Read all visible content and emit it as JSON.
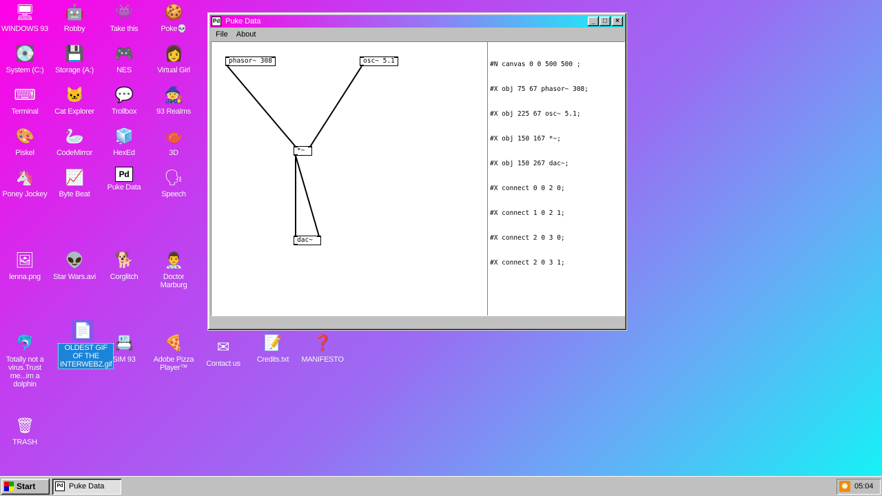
{
  "desktop": {
    "icons": [
      {
        "label": "WINDOWS 93",
        "glyph": "🖥"
      },
      {
        "label": "Robby",
        "glyph": "🤖"
      },
      {
        "label": "Take this",
        "glyph": "👾"
      },
      {
        "label": "Poke💀",
        "glyph": "🍪"
      },
      {
        "label": "System (C:)",
        "glyph": "💽"
      },
      {
        "label": "Storage (A:)",
        "glyph": "💾"
      },
      {
        "label": "NES",
        "glyph": "🎮"
      },
      {
        "label": "Virtual Girl",
        "glyph": "👩"
      },
      {
        "label": "Terminal",
        "glyph": "⌨"
      },
      {
        "label": "Cat Explorer",
        "glyph": "🐱"
      },
      {
        "label": "Trollbox",
        "glyph": "💬"
      },
      {
        "label": "93 Realms",
        "glyph": "🧙"
      },
      {
        "label": "Piskel",
        "glyph": "🎨"
      },
      {
        "label": "CodeMirror",
        "glyph": "🦢"
      },
      {
        "label": "HexEd",
        "glyph": "🧊"
      },
      {
        "label": "3D",
        "glyph": "🫖"
      },
      {
        "label": "Poney Jockey",
        "glyph": "🦄"
      },
      {
        "label": "Byte Beat",
        "glyph": "📈"
      },
      {
        "label": "Puke Data",
        "glyph": "Pd"
      },
      {
        "label": "Speech",
        "glyph": "🗣"
      },
      {
        "label": "lenna.png",
        "glyph": "🖼"
      },
      {
        "label": "Star Wars.avi",
        "glyph": "👽"
      },
      {
        "label": "Corglitch",
        "glyph": "🐕"
      },
      {
        "label": "Doctor Marburg",
        "glyph": "👨‍⚕"
      },
      {
        "label": "Totally not a virus.Trust me...im a dolphin",
        "glyph": "🐬"
      },
      {
        "label": "OLDEST GIF OF THE INTERWEBZ.gif",
        "glyph": "📄"
      },
      {
        "label": "SIM 93",
        "glyph": "📇"
      },
      {
        "label": "Adobe Pizza Player™",
        "glyph": "🍕"
      },
      {
        "label": "Contact us",
        "glyph": "✉"
      },
      {
        "label": "Credits.txt",
        "glyph": "📝"
      },
      {
        "label": "MANIFESTO",
        "glyph": "❓"
      },
      {
        "label": "TRASH",
        "glyph": "🗑"
      }
    ]
  },
  "window": {
    "title": "Puke Data",
    "title_icon": "Pd",
    "controls": {
      "minimize": "_",
      "maximize": "□",
      "close": "×"
    },
    "menu": [
      "File",
      "About"
    ],
    "patch": {
      "objects": [
        {
          "text": "phasor~ 308"
        },
        {
          "text": "osc~ 5.1"
        },
        {
          "text": "*~"
        },
        {
          "text": "dac~"
        }
      ],
      "connections": [
        {
          "from": 0,
          "outlet": 0,
          "to": 2,
          "inlet": 0
        },
        {
          "from": 1,
          "outlet": 0,
          "to": 2,
          "inlet": 1
        },
        {
          "from": 2,
          "outlet": 0,
          "to": 3,
          "inlet": 0
        },
        {
          "from": 2,
          "outlet": 0,
          "to": 3,
          "inlet": 1
        }
      ]
    },
    "source_lines": [
      "#N canvas 0 0 500 500 ;",
      "#X obj 75 67 phasor~ 308;",
      "#X obj 225 67 osc~ 5.1;",
      "#X obj 150 167 *~;",
      "#X obj 150 267 dac~;",
      "#X connect 0 0 2 0;",
      "#X connect 1 0 2 1;",
      "#X connect 2 0 3 0;",
      "#X connect 2 0 3 1;"
    ]
  },
  "taskbar": {
    "start_label": "Start",
    "task_label": "Puke Data",
    "task_icon": "Pd",
    "tray_icon": "rss-icon",
    "clock": "05:04"
  }
}
